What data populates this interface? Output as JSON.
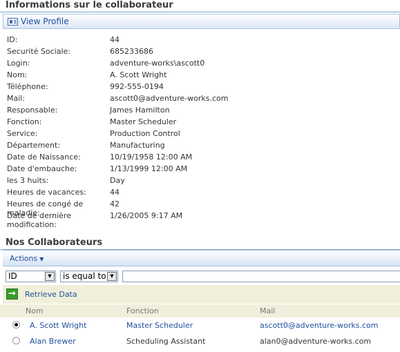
{
  "info_section": {
    "title": "Informations sur le collaborateur",
    "view_profile_label": "View Profile",
    "fields": [
      {
        "label": "ID:",
        "value": "44"
      },
      {
        "label": "Securité Sociale:",
        "value": "685233686"
      },
      {
        "label": "Login:",
        "value": "adventure-works\\ascott0"
      },
      {
        "label": "Nom:",
        "value": "A. Scott Wright"
      },
      {
        "label": "Téléphone:",
        "value": "992-555-0194"
      },
      {
        "label": "Mail:",
        "value": "ascott0@adventure-works.com"
      },
      {
        "label": "Responsable:",
        "value": "James Hamilton"
      },
      {
        "label": "Fonction:",
        "value": "Master Scheduler"
      },
      {
        "label": "Service:",
        "value": "Production Control"
      },
      {
        "label": "Département:",
        "value": "Manufacturing"
      },
      {
        "label": "Date de Naissance:",
        "value": "10/19/1958 12:00 AM"
      },
      {
        "label": "Date d'embauche:",
        "value": "1/13/1999 12:00 AM"
      },
      {
        "label": "les 3 huits:",
        "value": "Day"
      },
      {
        "label": "Heures de vacances:",
        "value": "44"
      },
      {
        "label": "Heures de congé de maladie:",
        "value": "42"
      },
      {
        "label": "Date de dernière modification:",
        "value": "1/26/2005 9:17 AM"
      }
    ]
  },
  "collaborators_section": {
    "title": "Nos Collaborateurs",
    "actions_label": "Actions",
    "filter": {
      "field_selected": "ID",
      "operator_selected": "is equal to",
      "value": ""
    },
    "retrieve_label": "Retrieve Data",
    "columns": [
      "Nom",
      "Fonction",
      "Mail"
    ],
    "rows": [
      {
        "selected": true,
        "nom": "A. Scott Wright",
        "fonction": "Master Scheduler",
        "mail": "ascott0@adventure-works.com"
      },
      {
        "selected": false,
        "nom": "Alan Brewer",
        "fonction": "Scheduling Assistant",
        "mail": "alan0@adventure-works.com"
      }
    ]
  },
  "colors": {
    "link": "#1f4e9c",
    "header_band": "#f0efdb",
    "toolbar_border": "#a9c0e0"
  }
}
